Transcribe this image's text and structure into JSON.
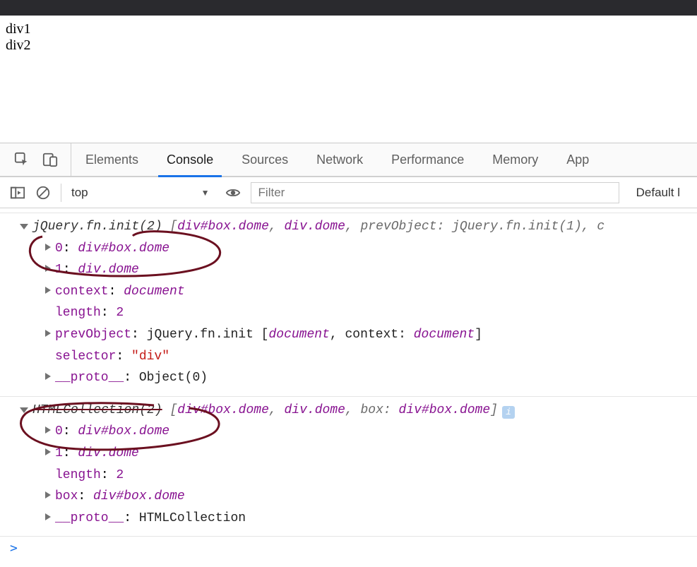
{
  "page": {
    "line1": "div1",
    "line2": "div2"
  },
  "devtools": {
    "tabs": {
      "elements": "Elements",
      "console": "Console",
      "sources": "Sources",
      "network": "Network",
      "performance": "Performance",
      "memory": "Memory",
      "application": "App"
    },
    "toolbar": {
      "context": "top",
      "filter_placeholder": "Filter",
      "level": "Default l"
    },
    "log1": {
      "header": {
        "type": "jQuery.fn.init(2)",
        "open": " [",
        "e0": "div#box.dome",
        "c1": ", ",
        "e1": "div.dome",
        "c2": ", prevObject: jQuery.fn.init(1), c",
        "close": ""
      },
      "r0": {
        "k": "0",
        "sep": ": ",
        "v": "div#box.dome"
      },
      "r1": {
        "k": "1",
        "sep": ": ",
        "v": "div.dome"
      },
      "r2": {
        "k": "context",
        "sep": ": ",
        "v": "document"
      },
      "r3": {
        "k": "length",
        "sep": ": ",
        "v": "2"
      },
      "r4": {
        "k": "prevObject",
        "sep": ": ",
        "pre": "jQuery.fn.init [",
        "a": "document",
        "mid": ", context: ",
        "b": "document",
        "post": "]"
      },
      "r5": {
        "k": "selector",
        "sep": ": ",
        "v": "\"div\""
      },
      "r6": {
        "k": "__proto__",
        "sep": ": ",
        "v": "Object(0)"
      }
    },
    "log2": {
      "header": {
        "type": "HTMLCollection(2)",
        "open": " [",
        "e0": "div#box.dome",
        "c1": ", ",
        "e1": "div.dome",
        "c2": ", box: ",
        "e2": "div#box.dome",
        "close": "]"
      },
      "r0": {
        "k": "0",
        "sep": ": ",
        "v": "div#box.dome"
      },
      "r1": {
        "k": "1",
        "sep": ": ",
        "v": "div.dome"
      },
      "r2": {
        "k": "length",
        "sep": ": ",
        "v": "2"
      },
      "r3": {
        "k": "box",
        "sep": ": ",
        "v": "div#box.dome"
      },
      "r4": {
        "k": "__proto__",
        "sep": ": ",
        "v": "HTMLCollection"
      }
    },
    "prompt": ">"
  }
}
